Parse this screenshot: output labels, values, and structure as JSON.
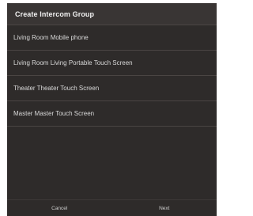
{
  "dialog": {
    "title": "Create Intercom Group",
    "items": [
      {
        "label": "Living Room Mobile phone"
      },
      {
        "label": "Living Room Living Portable Touch Screen"
      },
      {
        "label": "Theater Theater Touch Screen"
      },
      {
        "label": "Master Master Touch Screen"
      }
    ],
    "footer": {
      "cancel_label": "Cancel",
      "next_label": "Next"
    }
  },
  "colors": {
    "dialog_background": "#2e2b2a",
    "title_bar_background": "#393534",
    "divider": "#4a4543",
    "text": "#d9d9d9"
  }
}
